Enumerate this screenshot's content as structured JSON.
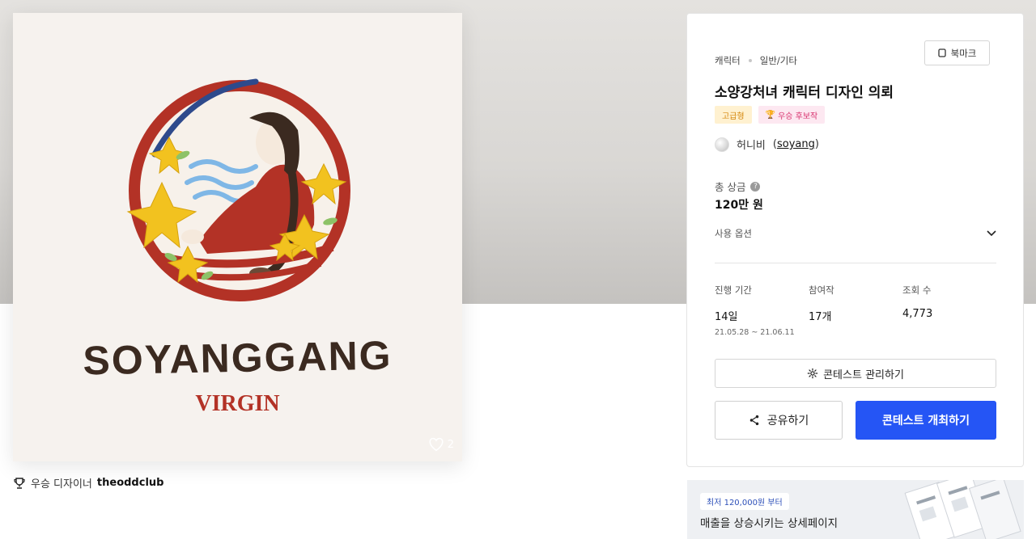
{
  "artwork": {
    "logo_main": "SOYANGGANG",
    "logo_sub": "VIRGIN",
    "like_count": "2",
    "colors": {
      "red": "#b33226",
      "yellow": "#f2c21f",
      "brown": "#3b2a20",
      "blue": "#7fb7e6"
    }
  },
  "winner": {
    "label": "우승 디자이너",
    "name": "theoddclub"
  },
  "contest": {
    "category": "캐릭터",
    "subcategory": "일반/기타",
    "bookmark_label": "북마크",
    "title": "소양강처녀 캐릭터 디자인 의뢰",
    "badges": [
      "고급형",
      "우승 후보작"
    ],
    "host_name": "허니비",
    "host_id": "soyang",
    "prize_label": "총 상금",
    "prize_value": "120만 원",
    "usage_label": "사용 옵션",
    "stats": {
      "period_label": "진행 기간",
      "period_value": "14일",
      "period_range": "21.05.28 ~ 21.06.11",
      "entries_label": "참여작",
      "entries_value": "17개",
      "views_label": "조회 수",
      "views_value": "4,773"
    },
    "manage_label": "콘테스트 관리하기",
    "share_label": "공유하기",
    "host_label": "콘테스트 개최하기",
    "accent": "#2555f5"
  },
  "promo": {
    "pill": "최저 120,000원 부터",
    "headline": "매출을 상승시키는 상세페이지"
  }
}
